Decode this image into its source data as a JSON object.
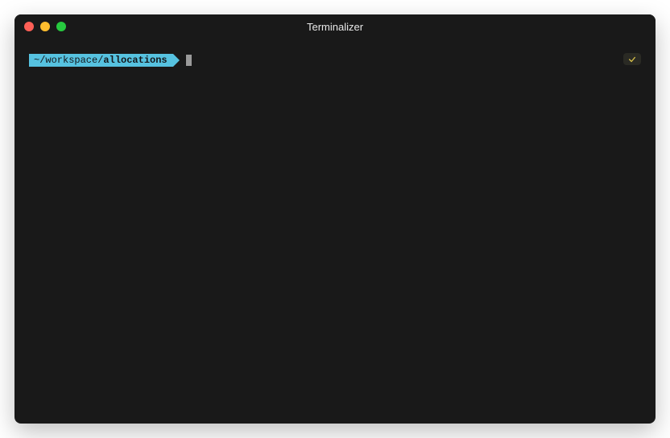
{
  "window": {
    "title": "Terminalizer"
  },
  "prompt": {
    "path_prefix": "~/workspace/",
    "path_current": "allocations"
  },
  "status": {
    "icon_name": "check-icon"
  }
}
